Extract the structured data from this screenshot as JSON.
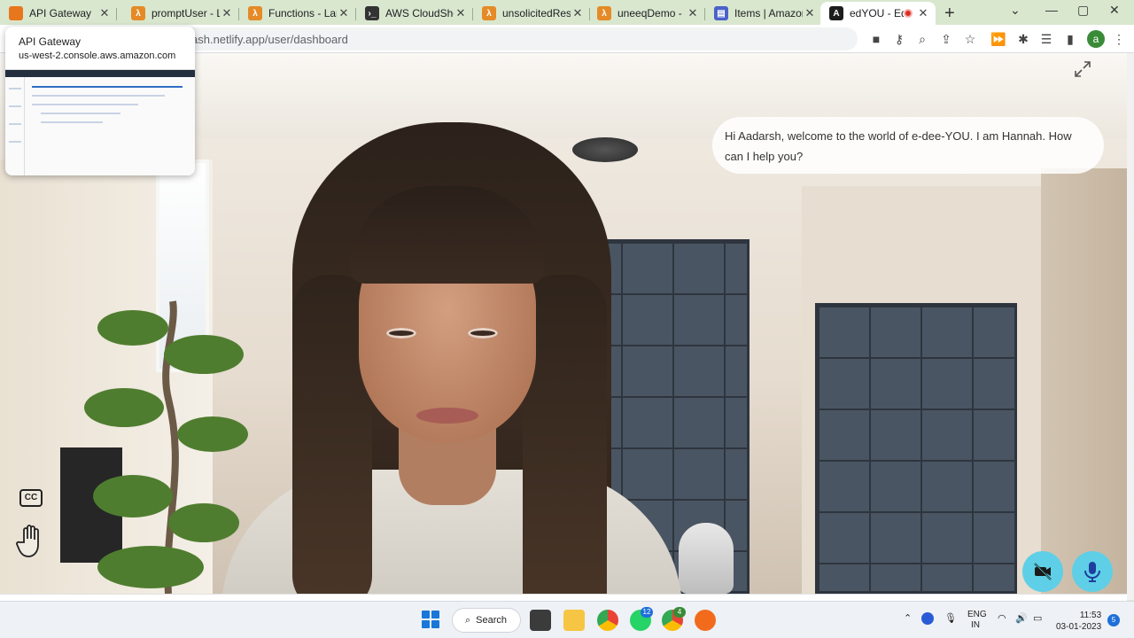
{
  "browser": {
    "tabs": [
      {
        "title": "API Gateway",
        "favicon": "aws-icon",
        "active": false
      },
      {
        "title": "promptUser - Lam",
        "favicon": "lambda-icon",
        "active": false
      },
      {
        "title": "Functions - Lamb",
        "favicon": "lambda-icon",
        "active": false
      },
      {
        "title": "AWS CloudShell",
        "favicon": "terminal-icon",
        "active": false
      },
      {
        "title": "unsolicitedRespo",
        "favicon": "lambda-icon",
        "active": false
      },
      {
        "title": "uneeqDemo - Lam",
        "favicon": "lambda-icon",
        "active": false
      },
      {
        "title": "Items | Amazon D",
        "favicon": "dynamodb-icon",
        "active": false
      },
      {
        "title": "edYOU - Edu",
        "favicon": "edyou-icon",
        "active": true,
        "recording": true
      }
    ],
    "url_visible": "ash.netlify.app/user/dashboard",
    "profile_initial": "a",
    "hover_card": {
      "title": "API Gateway",
      "domain": "us-west-2.console.aws.amazon.com"
    }
  },
  "page": {
    "chat_bubble": "Hi Aadarsh, welcome to the world of e-dee-YOU. I am Hannah. How can I help you?",
    "cc_label": "CC",
    "accent_color": "#5ecfe7"
  },
  "taskbar": {
    "search_label": "Search",
    "whatsapp_badge": "12",
    "chrome_badge": "4",
    "lang_top": "ENG",
    "lang_bottom": "IN",
    "time": "11:53",
    "date": "03-01-2023",
    "notifications": "5"
  }
}
